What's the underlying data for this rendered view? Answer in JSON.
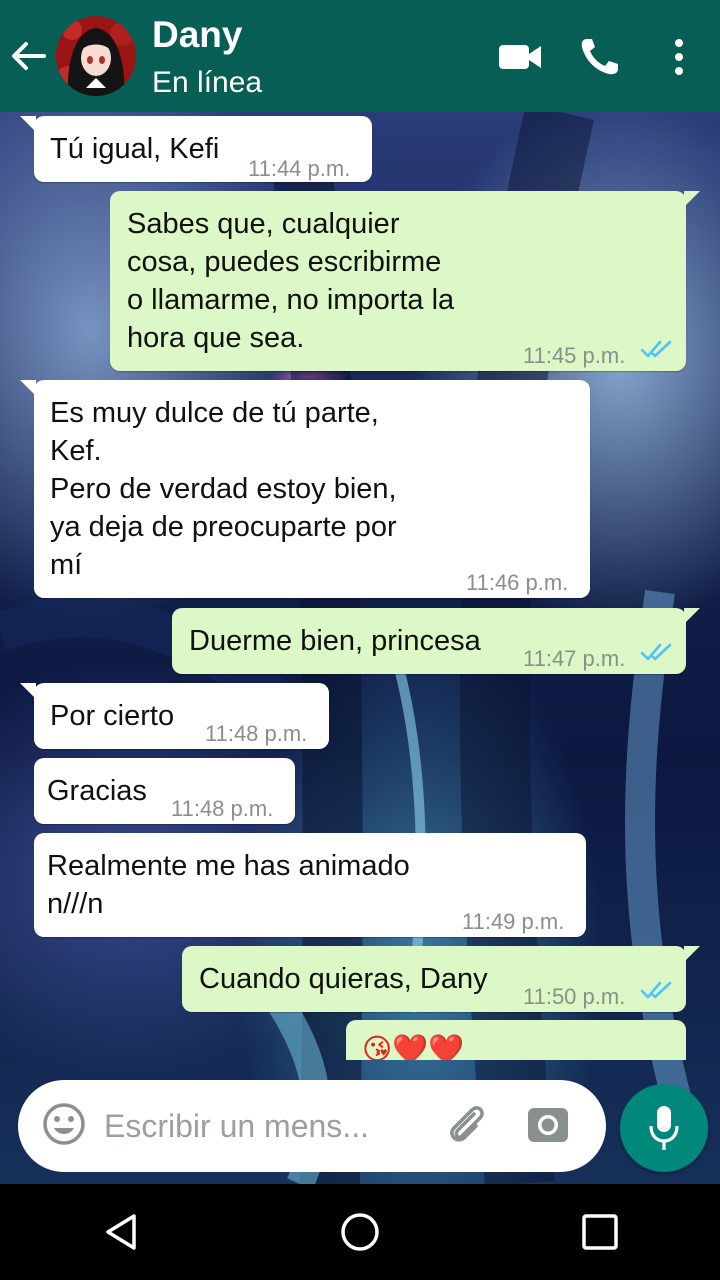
{
  "header": {
    "contact_name": "Dany",
    "contact_status": "En línea",
    "icons": [
      "back-arrow-icon",
      "video-call-icon",
      "phone-call-icon",
      "more-options-icon"
    ]
  },
  "messages": [
    {
      "direction": "incoming",
      "text": "Tú igual, Kefi",
      "time": "11:44 p.m."
    },
    {
      "direction": "outgoing",
      "text": "Sabes que, cualquier\ncosa, puedes escribirme\no llamarme, no importa la\nhora que sea.",
      "time": "11:45 p.m.",
      "status": "read"
    },
    {
      "direction": "incoming",
      "text": "Es muy dulce de tú parte,\nKef.\nPero de verdad estoy bien,\nya deja de preocuparte por\nmí",
      "time": "11:46 p.m."
    },
    {
      "direction": "outgoing",
      "text": "Duerme bien, princesa",
      "time": "11:47 p.m.",
      "status": "read"
    },
    {
      "direction": "incoming",
      "text": "Por cierto",
      "time": "11:48 p.m."
    },
    {
      "direction": "incoming",
      "text": "Gracias",
      "time": "11:48 p.m."
    },
    {
      "direction": "incoming",
      "text": "Realmente me has animado\nn///n",
      "time": "11:49 p.m."
    },
    {
      "direction": "outgoing",
      "text": "Cuando quieras, Dany",
      "time": "11:50 p.m.",
      "status": "read"
    },
    {
      "direction": "outgoing",
      "text": "😘❤️❤️",
      "time": "",
      "status": "read"
    }
  ],
  "input": {
    "placeholder": "Escribir un mens..."
  },
  "colors": {
    "header": "#075e54",
    "outgoing_bubble": "#dcf8c6",
    "incoming_bubble": "#ffffff",
    "read_ticks": "#4fc3f7",
    "mic_button": "#00897b"
  }
}
